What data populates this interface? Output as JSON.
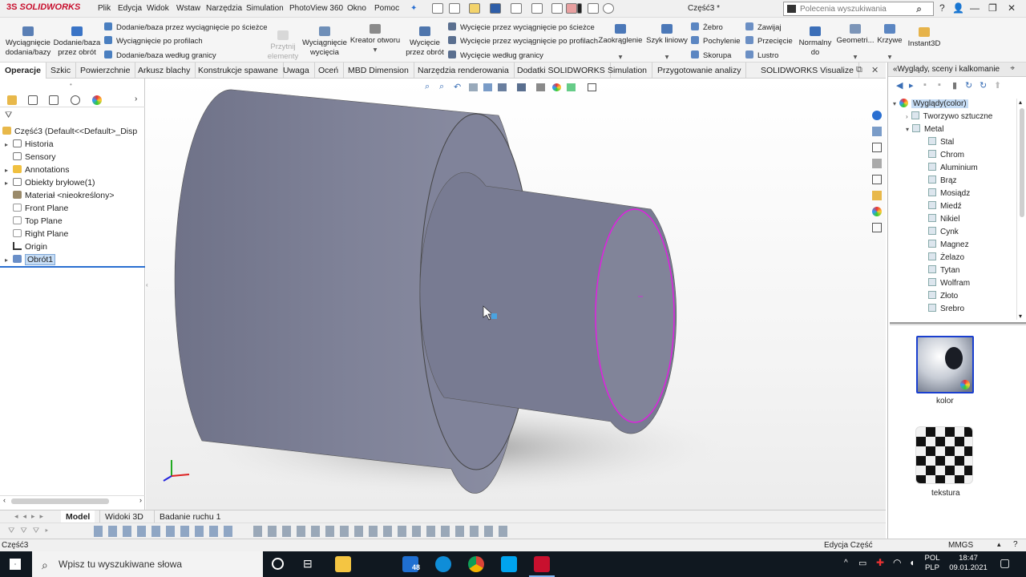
{
  "app": {
    "logo_prefix": "3S",
    "logo": "SOLIDWORKS",
    "document_title": "Część3 *"
  },
  "menu": [
    "Plik",
    "Edycja",
    "Widok",
    "Wstaw",
    "Narzędzia",
    "Simulation",
    "PhotoView 360",
    "Okno",
    "Pomoc"
  ],
  "search": {
    "placeholder": "Polecenia wyszukiwania"
  },
  "ribbon": {
    "big_buttons": [
      {
        "label1": "Wyciągnięcie",
        "label2": "dodania/bazy"
      },
      {
        "label1": "Dodanie/baza",
        "label2": "przez obrót"
      },
      {
        "label1": "Przytnij",
        "label2": "elementy"
      },
      {
        "label1": "Wyciągnięcie",
        "label2": "wycięcia"
      },
      {
        "label1": "Kreator otworu",
        "label2": ""
      },
      {
        "label1": "Wycięcie",
        "label2": "przez obrót"
      },
      {
        "label1": "Zaokrąglenie",
        "label2": ""
      },
      {
        "label1": "Szyk liniowy",
        "label2": ""
      },
      {
        "label1": "Normalny",
        "label2": "do"
      },
      {
        "label1": "Geometri...",
        "label2": ""
      },
      {
        "label1": "Krzywe",
        "label2": ""
      },
      {
        "label1": "Instant3D",
        "label2": ""
      }
    ],
    "rows_a": [
      "Dodanie/baza przez wyciągnięcie po ścieżce",
      "Wyciągnięcie po profilach",
      "Dodanie/baza według granicy"
    ],
    "rows_b": [
      "Wycięcie przez wyciągnięcie po ścieżce",
      "Wycięcie przez wyciągnięcie po profilach",
      "Wycięcie według granicy"
    ],
    "rows_c": [
      "Żebro",
      "Pochylenie",
      "Skorupa"
    ],
    "rows_d": [
      "Zawijaj",
      "Przecięcie",
      "Lustro"
    ]
  },
  "tabs": [
    "Operacje",
    "Szkic",
    "Powierzchnie",
    "Arkusz blachy",
    "Konstrukcje spawane",
    "Uwaga",
    "Oceń",
    "MBD Dimension",
    "Narzędzia renderowania",
    "Dodatki SOLIDWORKS",
    "Simulation",
    "Przygotowanie analizy",
    "SOLIDWORKS Visualize"
  ],
  "feature_tree": [
    {
      "label": "Część3  (Default<<Default>_Disp",
      "expand": ""
    },
    {
      "label": "Historia",
      "expand": "▸"
    },
    {
      "label": "Sensory",
      "expand": ""
    },
    {
      "label": "Annotations",
      "expand": "▸"
    },
    {
      "label": "Obiekty bryłowe(1)",
      "expand": "▸"
    },
    {
      "label": "Materiał <nieokreślony>",
      "expand": ""
    },
    {
      "label": "Front Plane",
      "expand": ""
    },
    {
      "label": "Top Plane",
      "expand": ""
    },
    {
      "label": "Right Plane",
      "expand": ""
    },
    {
      "label": "Origin",
      "expand": ""
    },
    {
      "label": "Obrót1",
      "expand": "▸"
    }
  ],
  "right_panel": {
    "title": "«Wyglądy, sceny i kalkomanie",
    "root": "Wyglądy(color)",
    "plastic": "Tworzywo sztuczne",
    "metal": "Metal",
    "metals": [
      "Stal",
      "Chrom",
      "Aluminium",
      "Brąz",
      "Mosiądz",
      "Miedź",
      "Nikiel",
      "Cynk",
      "Magnez",
      "Żelazo",
      "Tytan",
      "Wolfram",
      "Złoto",
      "Srebro"
    ],
    "thumb1_label": "kolor",
    "thumb2_label": "tekstura"
  },
  "bottom_tabs": [
    "Model",
    "Widoki 3D",
    "Badanie ruchu 1"
  ],
  "status": {
    "left": "Część3",
    "mode": "Edycja Część",
    "units": "MMGS"
  },
  "taskbar": {
    "search_placeholder": "Wpisz tu wyszukiwane słowa",
    "mail_badge": "48",
    "lang1": "POL",
    "lang2": "PLP",
    "time": "18:47",
    "date": "09.01.2021"
  },
  "colors": {
    "accent": "#c8102e",
    "model_body": "#7c7f96",
    "edge_highlight": "#e020e0",
    "selection": "#c5dcf5"
  }
}
